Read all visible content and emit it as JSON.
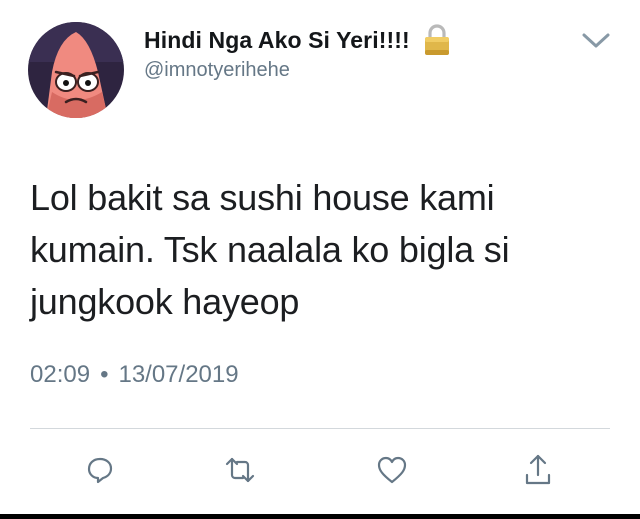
{
  "tweet": {
    "display_name": "Hindi Nga Ako Si Yeri!!!!",
    "handle": "@imnotyerihehe",
    "text": "Lol bakit sa sushi house kami kumain. Tsk naalala ko bigla si jungkook hayeop",
    "time": "02:09",
    "separator": "•",
    "date": "13/07/2019"
  },
  "icons": {
    "lock": "lock-icon",
    "menu": "chevron-down-icon",
    "reply": "reply-icon",
    "retweet": "retweet-icon",
    "like": "heart-icon",
    "share": "share-icon"
  },
  "colors": {
    "name": "#14171a",
    "secondary": "#657786",
    "body": "#1c1e21",
    "divider": "#d3d8dc",
    "avatar_bg": "#2e2440",
    "avatar_face": "#f08a80"
  }
}
